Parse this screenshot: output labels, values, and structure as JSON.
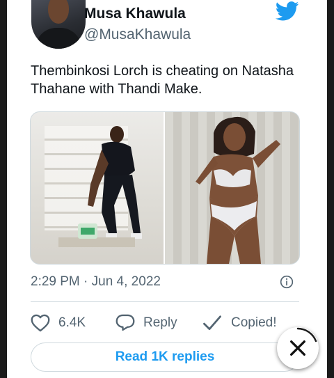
{
  "tweet": {
    "author_name": "Musa Khawula",
    "author_handle": "@MusaKhawula",
    "text": "Thembinkosi Lorch is cheating on Natasha Thahane with Thandi Make.",
    "timestamp": "2:29 PM · Jun 4, 2022",
    "likes_count": "6.4K",
    "reply_label": "Reply",
    "copy_label": "Copied!",
    "read_replies_label": "Read 1K replies"
  },
  "icons": {
    "brand": "twitter-bird-icon",
    "info": "info-icon",
    "like": "heart-icon",
    "reply": "speech-bubble-icon",
    "copy": "checkmark-icon",
    "close": "close-icon"
  },
  "colors": {
    "twitter_blue": "#1d9bf0",
    "text_primary": "#0f1419",
    "text_secondary": "#536471",
    "border": "#cfd9de"
  }
}
